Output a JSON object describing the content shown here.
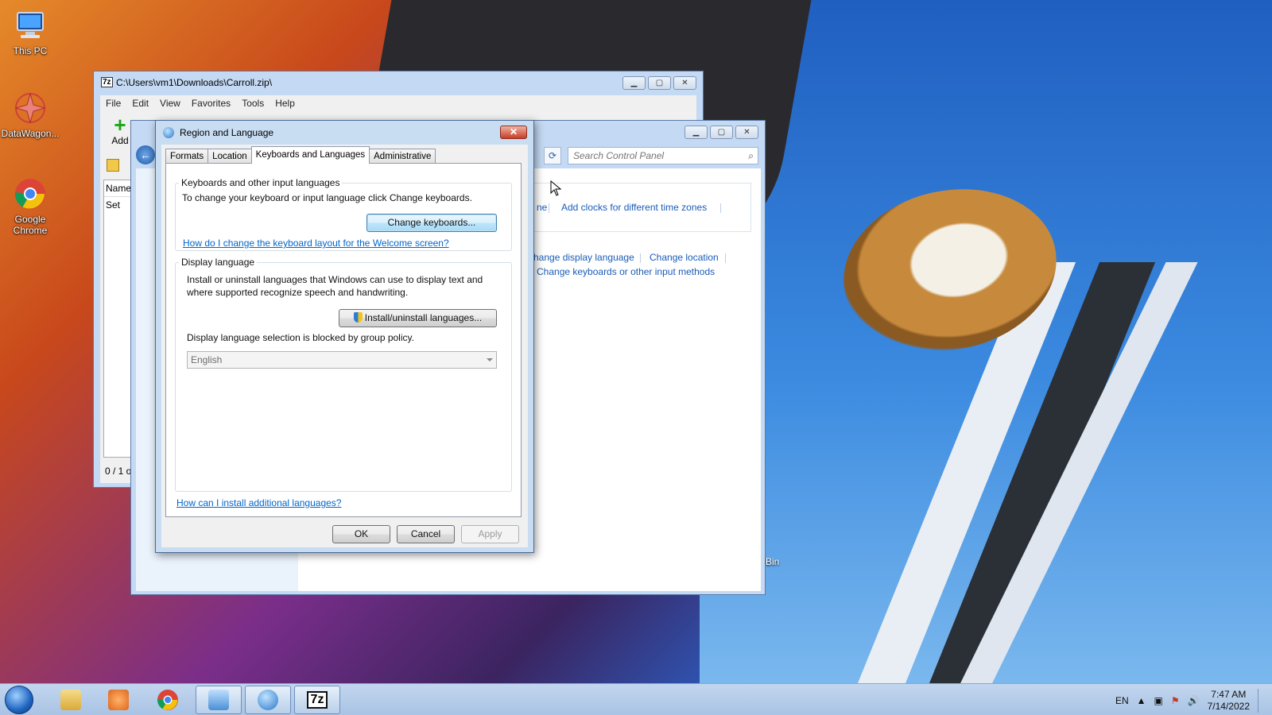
{
  "desktop": {
    "icons": [
      {
        "label": "This PC"
      },
      {
        "label": "DataWagon..."
      },
      {
        "label": "Google Chrome"
      }
    ],
    "recycle_fragment": "Bin"
  },
  "zip_window": {
    "title": "C:\\Users\\vm1\\Downloads\\Carroll.zip\\",
    "menu": [
      "File",
      "Edit",
      "View",
      "Favorites",
      "Tools",
      "Help"
    ],
    "add_label": "Add",
    "list_header": "Name",
    "list_item": "Set",
    "status": "0 / 1 ol"
  },
  "control_panel": {
    "search_placeholder": "Search Control Panel",
    "links": {
      "time_fragment": "ne",
      "add_clocks": "Add clocks for different time zones",
      "change_display_language": "hange display language",
      "change_location": "Change location",
      "change_keyboards": "Change keyboards or other input methods"
    }
  },
  "dialog": {
    "title": "Region and Language",
    "close_label": "✕",
    "tabs": [
      "Formats",
      "Location",
      "Keyboards and Languages",
      "Administrative"
    ],
    "keyboards_group": {
      "title": "Keyboards and other input languages",
      "description": "To change your keyboard or input language click Change keyboards.",
      "button": "Change keyboards...",
      "help_link": "How do I change the keyboard layout for the Welcome screen?"
    },
    "display_group": {
      "title": "Display language",
      "description_line1": "Install or uninstall languages that Windows can use to display text and",
      "description_line2": "where supported recognize speech and handwriting.",
      "button": "Install/uninstall languages...",
      "blocked_text": "Display language selection is blocked by group policy.",
      "selected_language": "English"
    },
    "install_link": "How can I install additional languages?",
    "buttons": {
      "ok": "OK",
      "cancel": "Cancel",
      "apply": "Apply"
    }
  },
  "taskbar": {
    "language": "EN",
    "time": "7:47 AM",
    "date": "7/14/2022"
  }
}
